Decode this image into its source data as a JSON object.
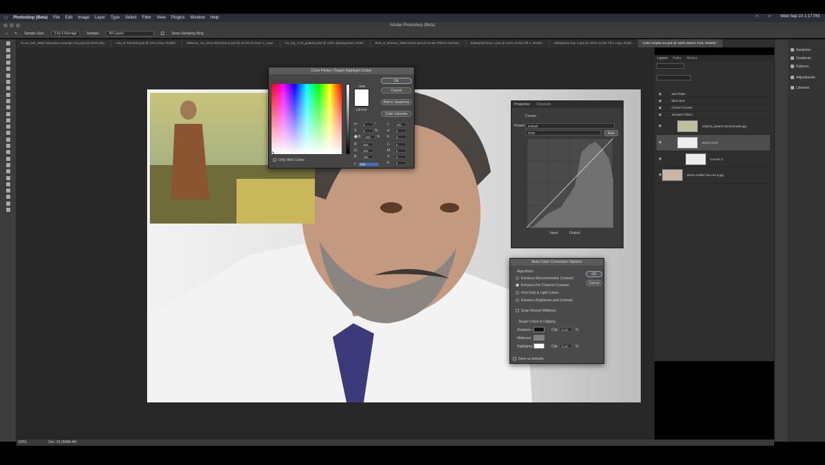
{
  "menubar": {
    "app": "Photoshop (Beta)",
    "items": [
      "File",
      "Edit",
      "Image",
      "Layer",
      "Type",
      "Select",
      "Filter",
      "View",
      "Plugins",
      "Window",
      "Help"
    ],
    "clock": "Wed Sep 10  1:17 PM"
  },
  "window_title": "Adobe Photoshop (Beta)",
  "options": {
    "sample_size_label": "Sample Size:",
    "sample_size_value": "5 by 5 Average",
    "sample_label": "Sample:",
    "sample_value": "All Layers",
    "show_ring": "Show Sampling Ring"
  },
  "tabs": [
    {
      "label": "Nt-res_MC_5562 Saturation example V1a.psd @ 100% (De...",
      "active": false
    },
    {
      "label": "Amy at Tahoe03.psd @ 10% (Amy, RGB/8...",
      "active": false
    },
    {
      "label": "Dibbens_AS_2413-W2d Demo.psd @ 33.3% (Curves 1_Laye...",
      "active": false
    },
    {
      "label": "CD_Fig_1-10_guitarist.psd @ 100% (Background, RGB/...",
      "active": false
    },
    {
      "label": "Shot_8_Window_0865-Demo.psd @ 61.9% (Pillow Hue/Sat...",
      "active": false
    },
    {
      "label": "JaiMayhew Exp 2.psd @ 100% (Color Fill 1, RGB/8...",
      "active": false
    },
    {
      "label": "JaiMayhew Exp 1.psd @ 100% (Color Fill 1 copy, RGB/...",
      "active": false
    },
    {
      "label": "Color Grades w1.psd @ 100% (Demo Crvs, RGB/8) *",
      "active": true
    }
  ],
  "status": {
    "zoom": "100%",
    "doc": "Doc: 23.0M/88.4M"
  },
  "color_picker": {
    "title": "Color Picker (Target Highlight Color)",
    "ok": "OK",
    "cancel": "Cancel",
    "add_swatches": "Add to Swatches",
    "color_libraries": "Color Libraries",
    "new_label": "new",
    "current_label": "current",
    "only_web": "Only Web Colors",
    "fields": {
      "H": "0",
      "S": "0",
      "B": "100",
      "R": "255",
      "G": "255",
      "Bl": "255",
      "L": "100",
      "a": "0",
      "b": "0",
      "C": "0",
      "M": "0",
      "Y": "0",
      "K": "0",
      "hex": "ffffff"
    },
    "units": {
      "deg": "°",
      "pct": "%"
    }
  },
  "properties": {
    "tab1": "Properties",
    "tab2": "Channels",
    "section": "Curves",
    "preset_label": "Preset:",
    "preset_value": "Default",
    "channel": "RGB",
    "auto": "Auto",
    "input": "Input:",
    "output": "Output:"
  },
  "auto_color": {
    "title": "Auto Color Correction Options",
    "algorithms": "Algorithms",
    "opts": [
      "Enhance Monochromatic Contrast",
      "Enhance Per Channel Contrast",
      "Find Dark & Light Colors",
      "Enhance Brightness and Contrast"
    ],
    "snap": "Snap Neutral Midtones",
    "targets": "Target Colors & Clipping",
    "shadows": "Shadows:",
    "midtones": "Midtones:",
    "highlights": "Highlights:",
    "clip": "Clip:",
    "clip_shadow": "0.10",
    "clip_highlight": "0.10",
    "pct": "%",
    "save_default": "Save as defaults",
    "ok": "OK",
    "cancel": "Cancel"
  },
  "layers": {
    "tab1": "Layers",
    "tab2": "Paths",
    "tab3": "History",
    "rows": [
      "Wet Plate",
      "Blue tone",
      "Cross Process",
      "Jacques Oliver",
      "original_autumn-promenade.jpg",
      "Demo Crvs",
      "Curves 3",
      "Steve Helder low res 6.jpg"
    ]
  },
  "libraries": [
    "Swatches",
    "Gradients",
    "Patterns",
    "Adjustments",
    "Libraries"
  ],
  "colors": {
    "accent": "#3d6ec9",
    "panel": "#3b3b3b"
  }
}
